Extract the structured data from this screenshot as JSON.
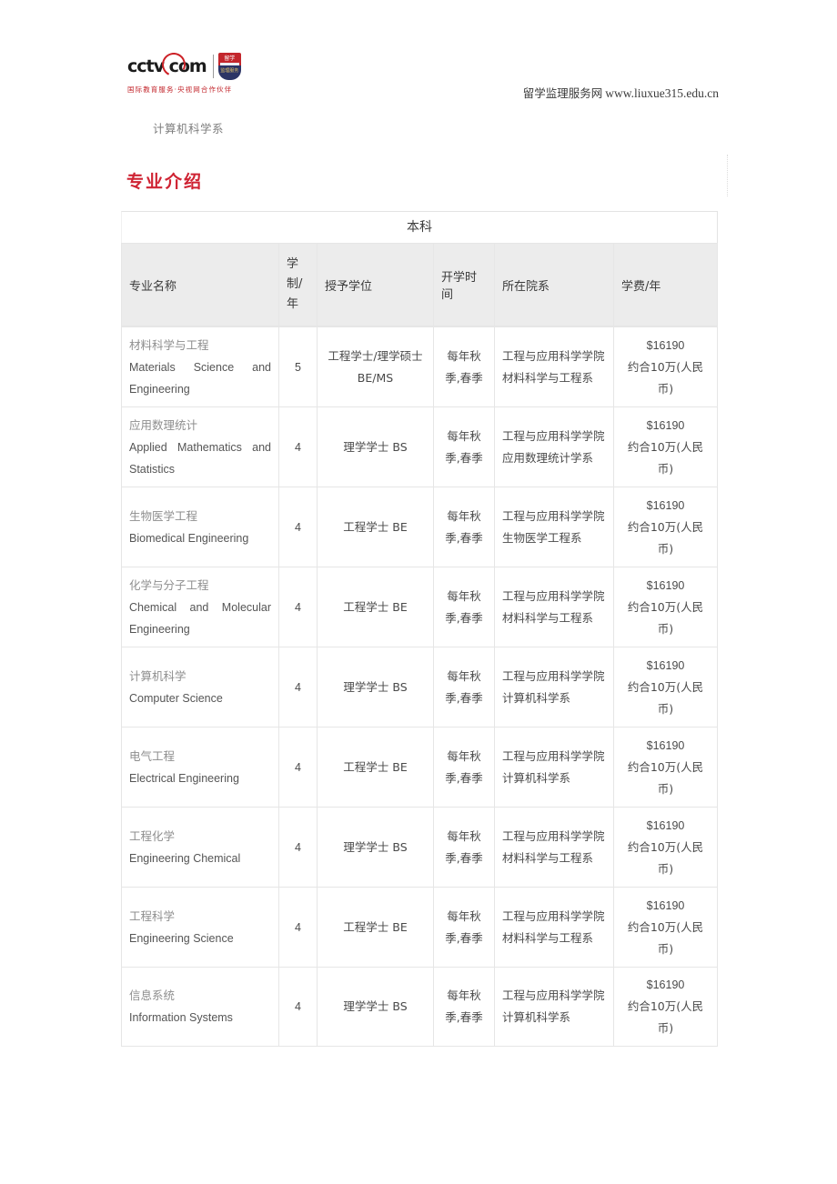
{
  "header": {
    "logo": {
      "wordmark": "cctv com",
      "wordmark_left": "cctv",
      "wordmark_right": "com",
      "tagline": "国际教育服务·央视网合作伙伴",
      "badge_top": "留学",
      "badge_bottom": "监理服务"
    },
    "site_name": "留学监理服务网",
    "site_url": "www.liuxue315.edu.cn",
    "department": "计算机科学系"
  },
  "section": {
    "title": "专业介绍"
  },
  "table": {
    "caption": "本科",
    "columns": [
      "专业名称",
      "学制/年",
      "授予学位",
      "开学时间",
      "所在院系",
      "学费/年"
    ],
    "rows": [
      {
        "name_cn": "材料科学与工程",
        "name_en": "Materials Science and Engineering",
        "years": "5",
        "degree": "工程学士/理学硕士 BE/MS",
        "start": "每年秋季,春季",
        "school_line1": "工程与应用科学学院",
        "school_line2": "材料科学与工程系",
        "fee_usd": "$16190",
        "fee_cny": "约合10万(人民币)"
      },
      {
        "name_cn": "应用数理统计",
        "name_en": "Applied Mathematics and Statistics",
        "years": "4",
        "degree": "理学学士 BS",
        "start": "每年秋季,春季",
        "school_line1": "工程与应用科学学院",
        "school_line2": "应用数理统计学系",
        "fee_usd": "$16190",
        "fee_cny": "约合10万(人民币)"
      },
      {
        "name_cn": "生物医学工程",
        "name_en": "Biomedical Engineering",
        "years": "4",
        "degree": "工程学士 BE",
        "start": "每年秋季,春季",
        "school_line1": "工程与应用科学学院",
        "school_line2": "生物医学工程系",
        "fee_usd": "$16190",
        "fee_cny": "约合10万(人民币)"
      },
      {
        "name_cn": "化学与分子工程",
        "name_en": "Chemical and Molecular Engineering",
        "years": "4",
        "degree": "工程学士 BE",
        "start": "每年秋季,春季",
        "school_line1": "工程与应用科学学院",
        "school_line2": "材料科学与工程系",
        "fee_usd": "$16190",
        "fee_cny": "约合10万(人民币)"
      },
      {
        "name_cn": "计算机科学",
        "name_en": "Computer Science",
        "years": "4",
        "degree": "理学学士 BS",
        "start": "每年秋季,春季",
        "school_line1": "工程与应用科学学院",
        "school_line2": "计算机科学系",
        "fee_usd": "$16190",
        "fee_cny": "约合10万(人民币)"
      },
      {
        "name_cn": "电气工程",
        "name_en": "Electrical Engineering",
        "years": "4",
        "degree": "工程学士 BE",
        "start": "每年秋季,春季",
        "school_line1": "工程与应用科学学院",
        "school_line2": "计算机科学系",
        "fee_usd": "$16190",
        "fee_cny": "约合10万(人民币)"
      },
      {
        "name_cn": "工程化学",
        "name_en": "Engineering Chemical",
        "years": "4",
        "degree": "理学学士 BS",
        "start": "每年秋季,春季",
        "school_line1": "工程与应用科学学院",
        "school_line2": "材料科学与工程系",
        "fee_usd": "$16190",
        "fee_cny": "约合10万(人民币)"
      },
      {
        "name_cn": "工程科学",
        "name_en": "Engineering Science",
        "years": "4",
        "degree": "工程学士 BE",
        "start": "每年秋季,春季",
        "school_line1": "工程与应用科学学院",
        "school_line2": "材料科学与工程系",
        "fee_usd": "$16190",
        "fee_cny": "约合10万(人民币)"
      },
      {
        "name_cn": "信息系统",
        "name_en": "Information Systems",
        "years": "4",
        "degree": "理学学士 BS",
        "start": "每年秋季,春季",
        "school_line1": "工程与应用科学学院",
        "school_line2": "计算机科学系",
        "fee_usd": "$16190",
        "fee_cny": "约合10万(人民币)"
      }
    ]
  },
  "colors": {
    "accent_red": "#cf2333",
    "logo_red": "#c3262c",
    "header_bg": "#ececec",
    "border": "#e6e6e6",
    "text_muted": "#8e8e8e"
  }
}
